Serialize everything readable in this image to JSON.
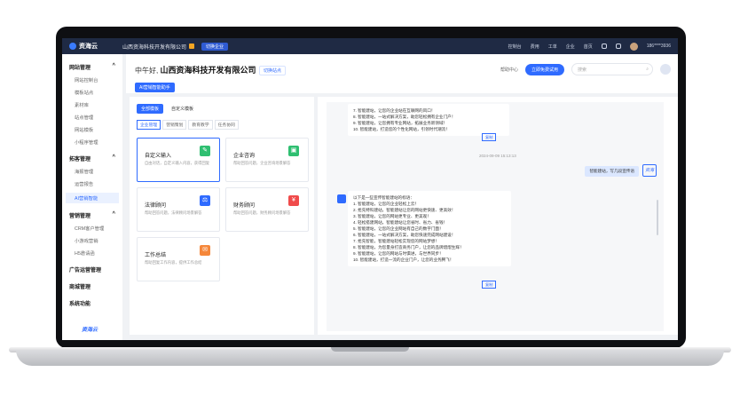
{
  "topbar": {
    "logo": "资海云",
    "company": "山西资海科技开发有限公司",
    "switch_label": "切换企业",
    "nav": [
      "控制台",
      "费用",
      "工单",
      "企业",
      "首页"
    ],
    "phone": "186****3936"
  },
  "sidebar": {
    "sections": [
      {
        "title": "网站管理",
        "items": [
          "网站控制台",
          "模板站点",
          "素材库",
          "站点管理",
          "网站模板",
          "小程序管理"
        ]
      },
      {
        "title": "拓客管理",
        "items": [
          "海报管理",
          "运营报告",
          "AI营销智能"
        ]
      },
      {
        "title": "营销管理",
        "items": [
          "CRM客户管理",
          "小游戏营销",
          "H5邀请函"
        ]
      },
      {
        "title": "广告运营管理",
        "items": []
      },
      {
        "title": "商城管理",
        "items": []
      },
      {
        "title": "系统功能",
        "items": []
      }
    ],
    "brand": "资海云"
  },
  "header": {
    "greeting": "中午好,",
    "company": "山西资海科技开发有限公司",
    "quick_label": "切换站点",
    "ai_tag": "AI营销智能助手",
    "help": "帮助中心",
    "cta": "立即免费试用",
    "search_placeholder": "搜索"
  },
  "left_panel": {
    "tabs": [
      "全部模板",
      "自定义模板"
    ],
    "subtabs": [
      "企业管理",
      "营销策划",
      "教育教学",
      "任务协同"
    ],
    "cards": [
      {
        "title": "自定义输入",
        "desc": "自由对话，自定义输入内容，获得回复",
        "icon": "✎",
        "color": "#2fbf71"
      },
      {
        "title": "企业咨询",
        "desc": "帮助回答问题，企业咨询场景解答",
        "icon": "▣",
        "color": "#2fbf71"
      },
      {
        "title": "法律顾问",
        "desc": "帮助回答问题，法律顾问场景解答",
        "icon": "⚖",
        "color": "#2f6bff"
      },
      {
        "title": "财务顾问",
        "desc": "帮助回答问题，财务顾问场景解答",
        "icon": "¥",
        "color": "#f04b4b"
      },
      {
        "title": "工作总结",
        "desc": "帮助回复工作内容，提供工作总结",
        "icon": "✉",
        "color": "#f5873a"
      }
    ]
  },
  "chat": {
    "top_lines": [
      "7. 智能建站，让您的企业站在互联网的风口！",
      "8. 智能建站，一站式解决方案，助您轻松拥有企业门户！",
      "9. 智能建站，让您拥有专业网站，拓展业务新领域！",
      "10. 智能建站，打造您的个性化网站，引领时代潮流！"
    ],
    "copy": "复制",
    "time": "2024-09-09 15:13:13",
    "user_msg": "智能建站，写几段宣传语",
    "user_avatar_label": "资海",
    "bot_lines": [
      "以下是一些宣传智能建站的标语：",
      "1. 智能建站，让您的企业轻松上云！",
      "2. 抢先特科建站，智能建站让您的网站更快速、更高效！",
      "3. 智能建站，让您的网站更专业、更美观！",
      "4. 轻松搭建网站，智能建站让您省时、省力、省钱！",
      "5. 智能建站，让您的企业网站有自己的数字门面！",
      "6. 智能建站，一站式解决方案，助您快速完成网站建设！",
      "7. 抢先智能，智能建站轻松实现您的网站梦想！",
      "8. 智能建站，为您量身打造商务门户，让您的品牌熠熠生辉！",
      "9. 智能建站，让您的网站与时俱进，与世界同步！",
      "10. 智能建站，打造一流的企业门户，让您的业务腾飞！"
    ]
  }
}
